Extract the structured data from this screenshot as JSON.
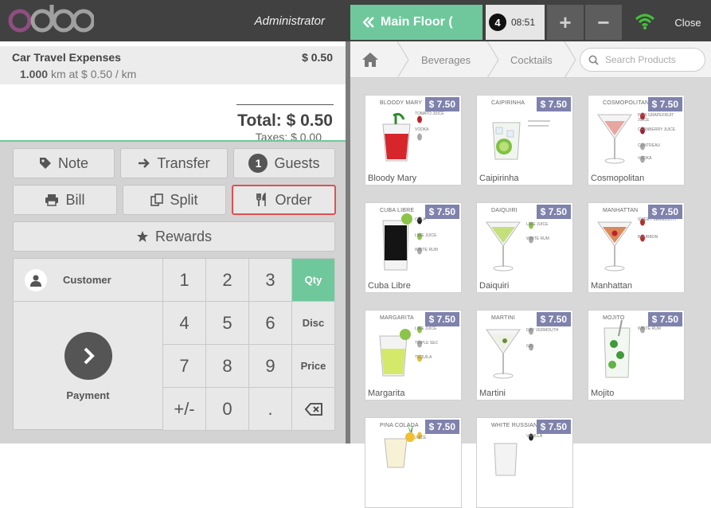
{
  "header": {
    "logo_text": "odoo",
    "cashier": "Administrator",
    "floor_label": "Main Floor (",
    "order_number": "4",
    "order_time": "08:51",
    "add_order_symbol": "+",
    "remove_order_symbol": "−",
    "close_label": "Close"
  },
  "order": {
    "lines": [
      {
        "name": "Car Travel Expenses",
        "price": "$ 0.50",
        "qty": "1.000",
        "detail": "km at $ 0.50 / km"
      }
    ],
    "total": "Total: $ 0.50",
    "taxes": "Taxes: $ 0.00"
  },
  "actions": {
    "note": "Note",
    "transfer": "Transfer",
    "guests_count": "1",
    "guests": "Guests",
    "bill": "Bill",
    "split": "Split",
    "order": "Order",
    "rewards": "Rewards"
  },
  "numpad": {
    "customer": "Customer",
    "payment": "Payment",
    "keys": [
      "1",
      "2",
      "3",
      "4",
      "5",
      "6",
      "7",
      "8",
      "9",
      "+/-",
      "0",
      "."
    ],
    "modes": [
      "Qty",
      "Disc",
      "Price"
    ],
    "active_mode": "Qty"
  },
  "breadcrumbs": [
    "Beverages",
    "Cocktails"
  ],
  "search": {
    "placeholder": "Search Products"
  },
  "products": [
    {
      "name": "Bloody Mary",
      "price": "$ 7.50",
      "title": "BLOODY MARY",
      "ingredients": [
        "TOMATO JUICE",
        "VODKA"
      ]
    },
    {
      "name": "Caipirinha",
      "price": "$ 7.50",
      "title": "CAIPIRINHA",
      "ingredients": []
    },
    {
      "name": "Cosmopolitan",
      "price": "$ 7.50",
      "title": "COSMOPOLITAN",
      "ingredients": [
        "PINK GRAPEFRUIT JUICE",
        "CRANBERRY JUICE",
        "CONTREAU",
        "VODKA"
      ]
    },
    {
      "name": "Cuba Libre",
      "price": "$ 7.50",
      "title": "CUBA LIBRE",
      "ingredients": [
        "COLA",
        "LIME JUICE",
        "WHITE RUM"
      ]
    },
    {
      "name": "Daiquiri",
      "price": "$ 7.50",
      "title": "DAIQUIRI",
      "ingredients": [
        "LIME JUICE",
        "WHITE RUM"
      ]
    },
    {
      "name": "Manhattan",
      "price": "$ 7.50",
      "title": "MANHATTAN",
      "ingredients": [
        "SWEET VERMOUTH",
        "BOURBON"
      ]
    },
    {
      "name": "Margarita",
      "price": "$ 7.50",
      "title": "MARGARITA",
      "ingredients": [
        "LIME JUICE",
        "TRIPLE SEC",
        "TEQUILA"
      ]
    },
    {
      "name": "Martini",
      "price": "$ 7.50",
      "title": "MARTINI",
      "ingredients": [
        "DRY VERMOUTH",
        "GIN"
      ]
    },
    {
      "name": "Mojito",
      "price": "$ 7.50",
      "title": "MOJITO",
      "ingredients": [
        "WHITE RUM"
      ]
    },
    {
      "name": "",
      "price": "$ 7.50",
      "title": "PINA COLADA",
      "ingredients": [
        "JUICE"
      ]
    },
    {
      "name": "",
      "price": "$ 7.50",
      "title": "WHITE RUSSIAN",
      "ingredients": [
        "VANILLA"
      ]
    }
  ],
  "colors": {
    "topbar": "#414141",
    "accent_green": "#6ec89b",
    "price_badge": "#7f82ac",
    "highlight_red": "#e05050"
  },
  "icons": [
    "home-icon",
    "search-icon",
    "tag-icon",
    "arrow-right-icon",
    "printer-icon",
    "copy-icon",
    "cutlery-icon",
    "star-icon",
    "user-icon",
    "chevron-right-icon",
    "backspace-icon",
    "wifi-icon",
    "double-chevron-left-icon"
  ]
}
